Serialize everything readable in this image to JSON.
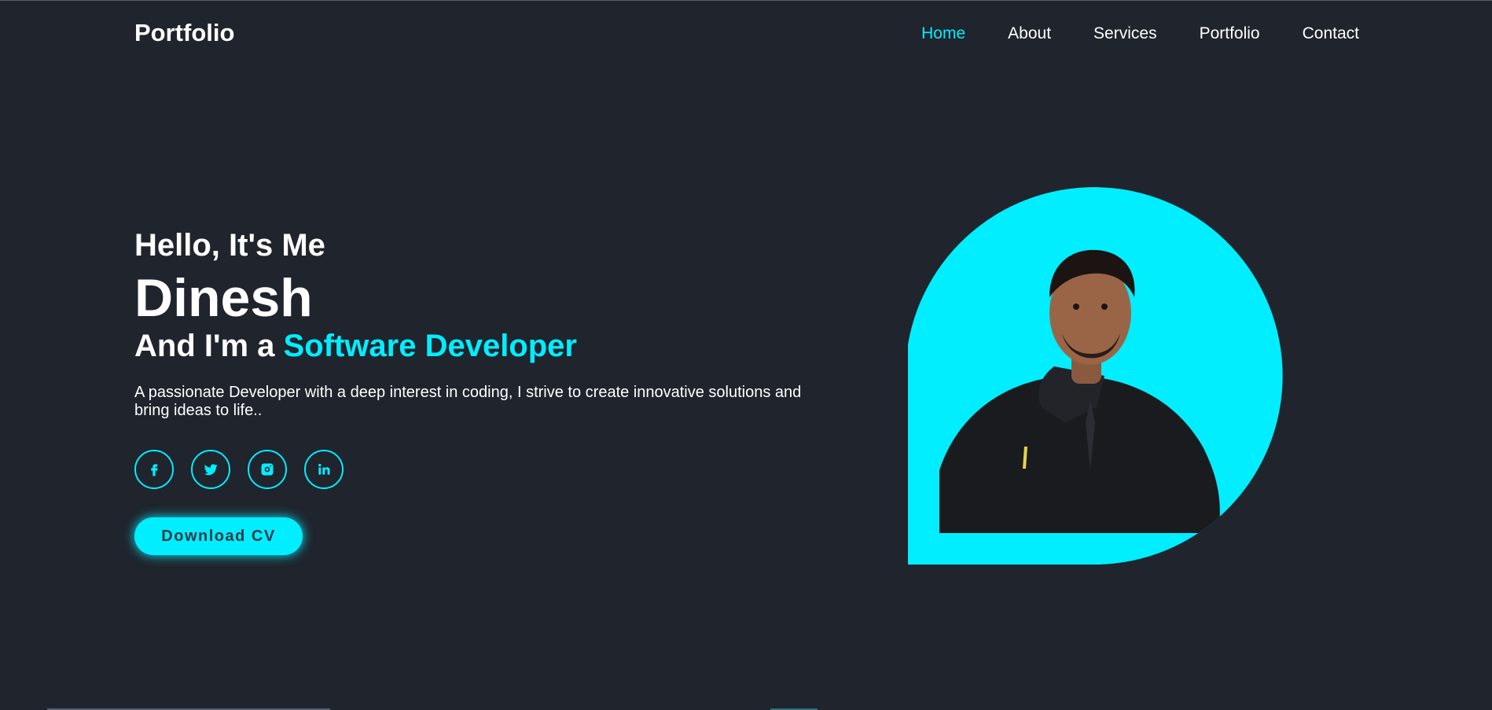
{
  "header": {
    "logo": "Portfolio",
    "nav": [
      {
        "label": "Home",
        "active": true
      },
      {
        "label": "About",
        "active": false
      },
      {
        "label": "Services",
        "active": false
      },
      {
        "label": "Portfolio",
        "active": false
      },
      {
        "label": "Contact",
        "active": false
      }
    ]
  },
  "home": {
    "greeting": "Hello, It's Me",
    "name": "Dinesh",
    "role_prefix": "And I'm a ",
    "role": "Software Developer",
    "description": "A passionate Developer with a deep interest in coding, I strive to create innovative solutions and bring ideas to life..",
    "socials": [
      {
        "icon": "facebook-icon"
      },
      {
        "icon": "twitter-icon"
      },
      {
        "icon": "instagram-icon"
      },
      {
        "icon": "linkedin-icon"
      }
    ],
    "cta_label": "Download CV"
  },
  "colors": {
    "background": "#1f242d",
    "accent": "#00eeff",
    "text": "#ffffff",
    "button_text": "#323946"
  }
}
